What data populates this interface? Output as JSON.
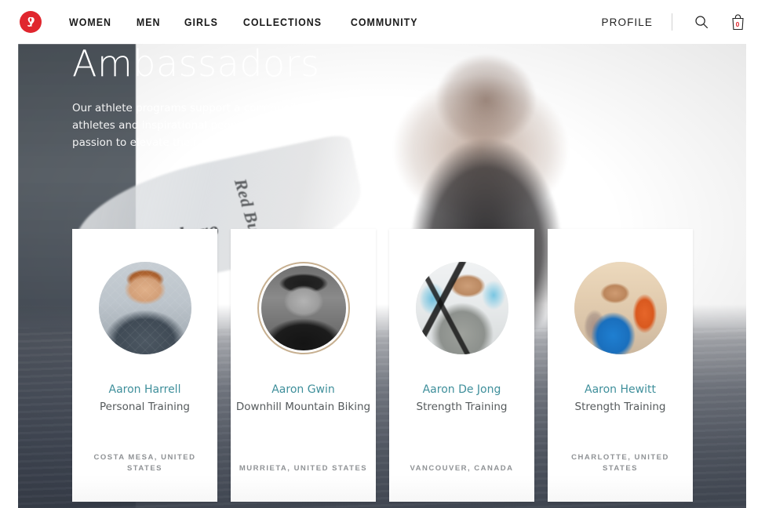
{
  "header": {
    "logo": {
      "name": "lululemon-logo",
      "color": "#e0262e"
    },
    "nav": [
      {
        "label": "WOMEN"
      },
      {
        "label": "MEN"
      },
      {
        "label": "GIRLS"
      },
      {
        "label": "COLLECTIONS"
      },
      {
        "label": "COMMUNITY"
      }
    ],
    "profile_label": "PROFILE",
    "search_icon": "search-icon",
    "bag_icon": "shopping-bag-icon",
    "bag_count": "0",
    "bag_count_color": "#e0262e"
  },
  "hero": {
    "title": "Ambassadors",
    "description": "Our athlete programs support a community of driven athletes and inspirational people who harness their passion to elevate their communities.",
    "board_brand": "Tokoro",
    "board_brand_alt": "Red Bull"
  },
  "cards": [
    {
      "name": "Aaron Harrell",
      "discipline": "Personal Training",
      "location": "COSTA MESA, UNITED STATES",
      "avatar": "avatar-aaron-harrell",
      "ringed": false
    },
    {
      "name": "Aaron Gwin",
      "discipline": "Downhill Mountain Biking",
      "location": "MURRIETA, UNITED STATES",
      "avatar": "avatar-aaron-gwin",
      "ringed": true
    },
    {
      "name": "Aaron De Jong",
      "discipline": "Strength Training",
      "location": "VANCOUVER, CANADA",
      "avatar": "avatar-aaron-de-jong",
      "ringed": false
    },
    {
      "name": "Aaron Hewitt",
      "discipline": "Strength Training",
      "location": "CHARLOTTE, UNITED STATES",
      "avatar": "avatar-aaron-hewitt",
      "ringed": false
    }
  ],
  "colors": {
    "brand_red": "#e0262e",
    "link_teal": "#3f8f9b",
    "body_text": "#555a5c",
    "location_text": "#8f9295"
  }
}
